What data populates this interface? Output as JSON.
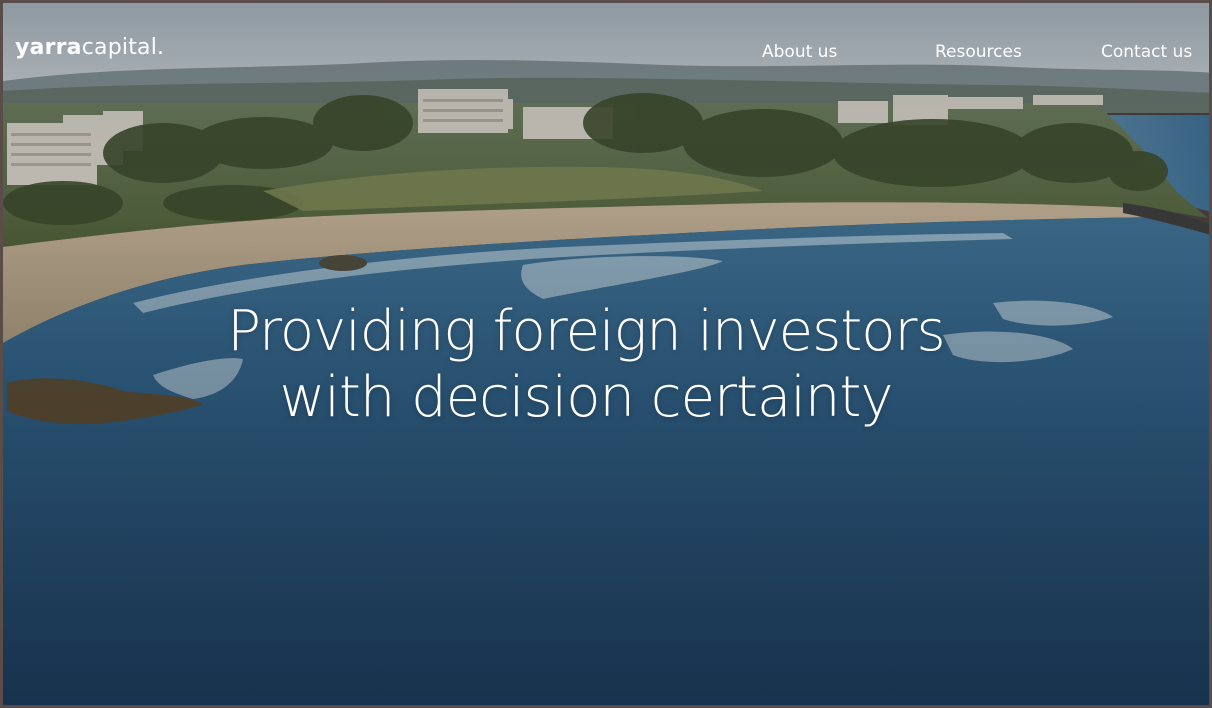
{
  "logo": {
    "brand": "yarra",
    "rest": "capital."
  },
  "nav": {
    "items": [
      {
        "label": "About us"
      },
      {
        "label": "Resources"
      },
      {
        "label": "Contact us"
      }
    ]
  },
  "hero": {
    "headline_line1": "Providing foreign investors",
    "headline_line2": "with decision certainty",
    "background": "aerial-coastline-photo"
  },
  "colors": {
    "text": "#ffffff",
    "ocean": "#2d5a7a",
    "sand": "#c9b49a",
    "vegetation": "#5d6e3c",
    "sky": "#b8c4cc",
    "frame": "#5a4c48"
  }
}
